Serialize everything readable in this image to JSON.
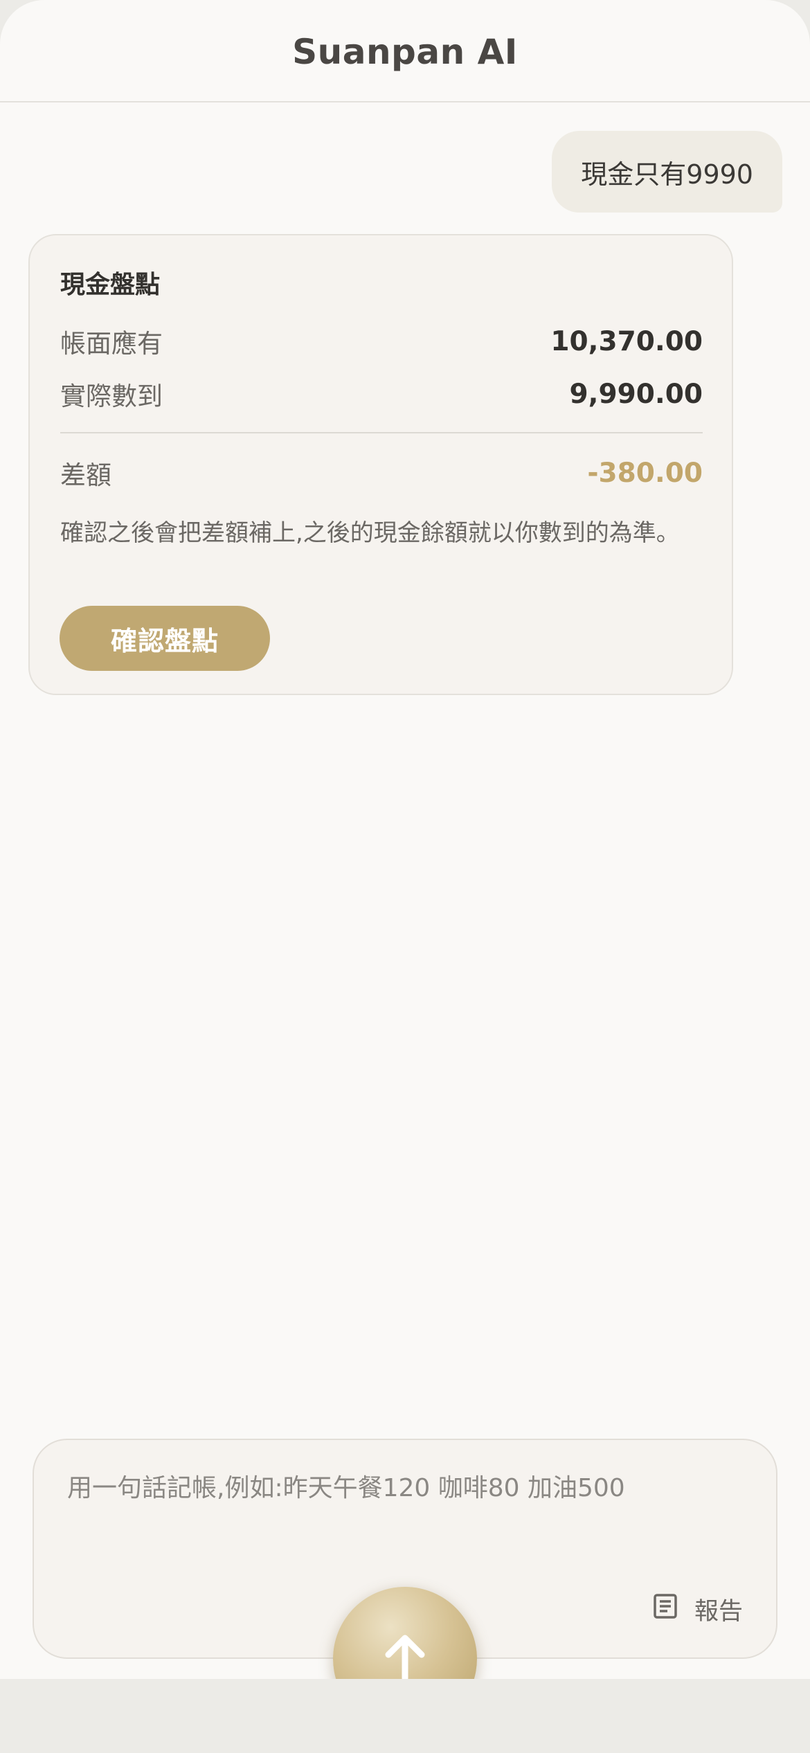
{
  "header": {
    "title": "Suanpan AI"
  },
  "chat": {
    "user_message": "現金只有9990",
    "card": {
      "title": "現金盤點",
      "book_label": "帳面應有",
      "book_value": "10,370.00",
      "counted_label": "實際數到",
      "counted_value": "9,990.00",
      "diff_label": "差額",
      "diff_value": "-380.00",
      "note": "確認之後會把差額補上,之後的現金餘額就以你數到的為準。",
      "confirm_label": "確認盤點"
    }
  },
  "composer": {
    "placeholder": "用一句話記帳,例如:昨天午餐120 咖啡80 加油500",
    "report_label": "報告",
    "report_icon": "document-icon",
    "send_icon": "arrow-up-icon"
  },
  "colors": {
    "accent": "#c0a872",
    "diff": "#c2a66b",
    "background": "#faf9f7"
  }
}
